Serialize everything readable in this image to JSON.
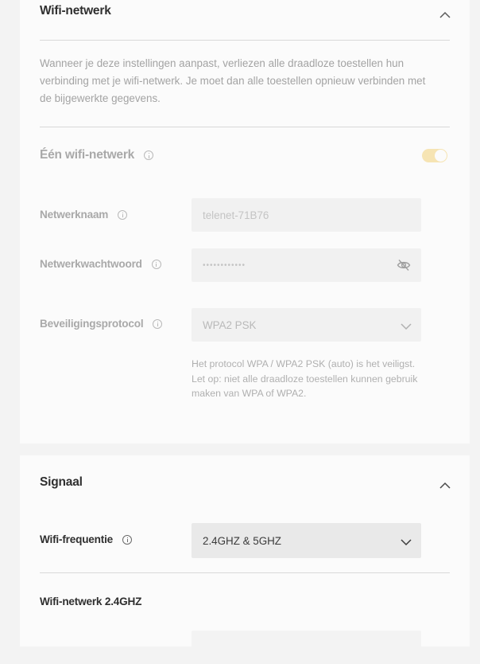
{
  "wifi_section": {
    "title": "Wifi-netwerk",
    "description": "Wanneer je deze instellingen aanpast, verliezen alle draadloze toestellen hun verbinding met je wifi-netwerk. Je moet dan alle toestellen opnieuw verbinden met de bijgewerkte gegevens.",
    "single_network": {
      "label": "Één wifi-netwerk",
      "enabled": true
    },
    "network_name": {
      "label": "Netwerknaam",
      "value": "telenet-71B76"
    },
    "network_password": {
      "label": "Netwerkwachtwoord",
      "value": "••••••••••••"
    },
    "security_protocol": {
      "label": "Beveiligingsprotocol",
      "value": "WPA2 PSK",
      "help": "Het protocol WPA / WPA2 PSK (auto) is het veiligst. Let op: niet alle draadloze toestellen kunnen gebruik maken van WPA of WPA2."
    }
  },
  "signal_section": {
    "title": "Signaal",
    "frequency": {
      "label": "Wifi-frequentie",
      "value": "2.4GHZ & 5GHZ"
    },
    "subsection_title": "Wifi-netwerk 2.4GHZ"
  },
  "colors": {
    "toggle_on": "#f6e4b3",
    "field_bg": "#f1f1f1"
  },
  "icons": [
    "chevron-up-icon",
    "info-icon",
    "eye-off-icon",
    "chevron-down-icon"
  ]
}
